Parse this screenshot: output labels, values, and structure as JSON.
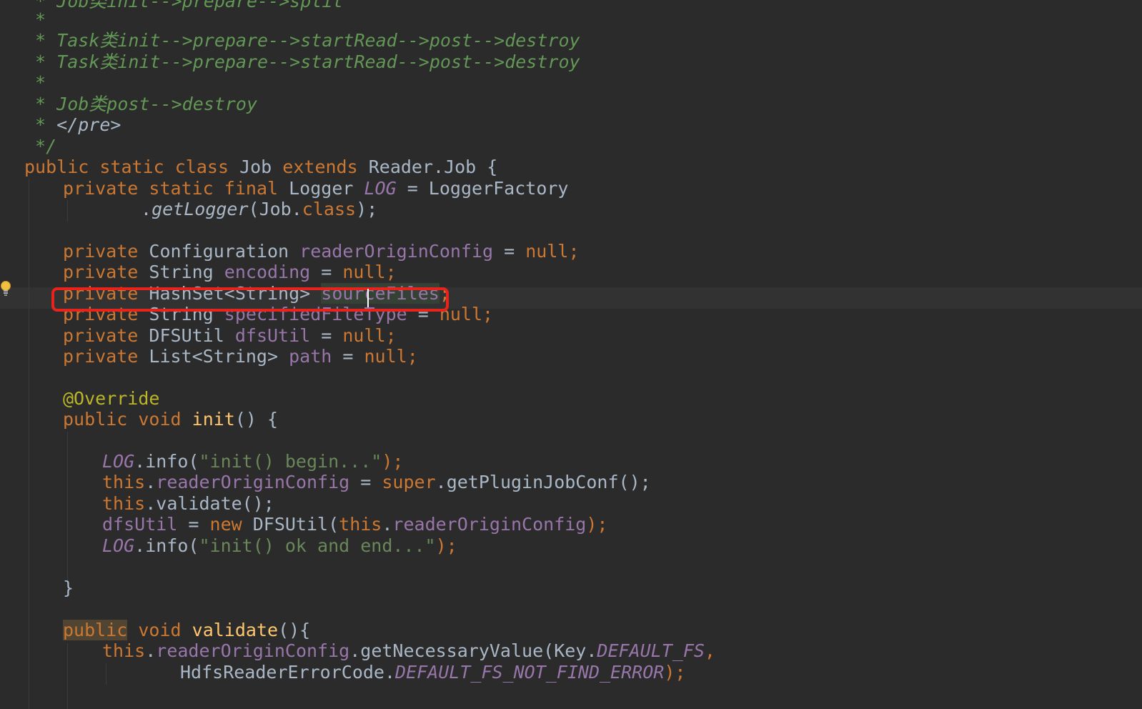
{
  "editor": {
    "comment_lines": {
      "l1": " * Job类init-->prepare-->split",
      "l2": " *",
      "l3": " * Task类init-->prepare-->startRead-->post-->destroy",
      "l4": " * Task类init-->prepare-->startRead-->post-->destroy",
      "l5": " *",
      "l6": " * Job类post-->destroy",
      "l7_prefix": " * ",
      "l7_tag": "</pre>",
      "l8": " */"
    },
    "code": {
      "class_decl": {
        "k1": "public",
        "k2": "static",
        "k3": "class",
        "name": "Job",
        "k4": "extends",
        "parent": "Reader.Job {"
      },
      "logger": {
        "k1": "private",
        "k2": "static",
        "k3": "final",
        "type": "Logger",
        "field": "LOG",
        "rest": " = LoggerFactory"
      },
      "logger_cont": {
        "dot": ".",
        "method": "getLogger",
        "open": "(Job.",
        "kw": "class",
        "close": ");"
      },
      "f1": {
        "k": "private",
        "type": "Configuration",
        "name": "readerOriginConfig",
        "eq": " = ",
        "val": "null",
        "end": ";"
      },
      "f2": {
        "k": "private",
        "type": "String",
        "name": "encoding",
        "eq": " = ",
        "val": "null",
        "end": ";"
      },
      "f3": {
        "k": "private",
        "type": "HashSet<String>",
        "name": "sourceFiles",
        "end": ";"
      },
      "f4": {
        "k": "private",
        "type": "String",
        "name": "specifiedFileType",
        "eq": " = ",
        "val": "null",
        "end": ";"
      },
      "f5": {
        "k": "private",
        "type": "DFSUtil",
        "name": "dfsUtil",
        "eq": " = ",
        "val": "null",
        "end": ";"
      },
      "f6": {
        "k": "private",
        "type": "List<String>",
        "name": "path",
        "eq": " = ",
        "val": "null",
        "end": ";"
      },
      "annotation": "@Override",
      "init_decl": {
        "k1": "public",
        "k2": "void",
        "name": "init",
        "rest": "() {"
      },
      "init_body": {
        "b1": {
          "obj": "LOG",
          "call": ".info(",
          "str": "\"init() begin...\"",
          "end": ");"
        },
        "b2": {
          "k": "this",
          "dot": ".",
          "field": "readerOriginConfig",
          "eq": " = ",
          "k2": "super",
          "rest": ".getPluginJobConf();"
        },
        "b3": {
          "k": "this",
          "rest": ".validate();"
        },
        "b4": {
          "field": "dfsUtil",
          "eq": " = ",
          "k": "new",
          "mid": " DFSUtil(",
          "k2": "this",
          "dot": ".",
          "field2": "readerOriginConfig",
          "end": ");"
        },
        "b5": {
          "obj": "LOG",
          "call": ".info(",
          "str": "\"init() ok and end...\"",
          "end": ");"
        }
      },
      "close_brace": "}",
      "validate_decl": {
        "k1": "public",
        "k2": "void",
        "name": "validate",
        "rest": "(){"
      },
      "validate_body": {
        "v1": {
          "k": "this",
          "dot": ".",
          "field": "readerOriginConfig",
          "mid": ".getNecessaryValue(Key.",
          "const": "DEFAULT_FS",
          "end": ","
        },
        "v2": {
          "pre": "HdfsReaderErrorCode.",
          "const": "DEFAULT_FS_NOT_FIND_ERROR",
          "end": ");"
        }
      }
    }
  },
  "colors": {
    "background": "#2b2b2b",
    "keyword": "#cc7832",
    "comment": "#629755",
    "field": "#9876aa",
    "string": "#6a8759",
    "annotation": "#bbb529",
    "method_decl": "#ffc66d",
    "highlight_box": "#e8231b"
  },
  "icons": [
    "lightbulb-icon"
  ]
}
